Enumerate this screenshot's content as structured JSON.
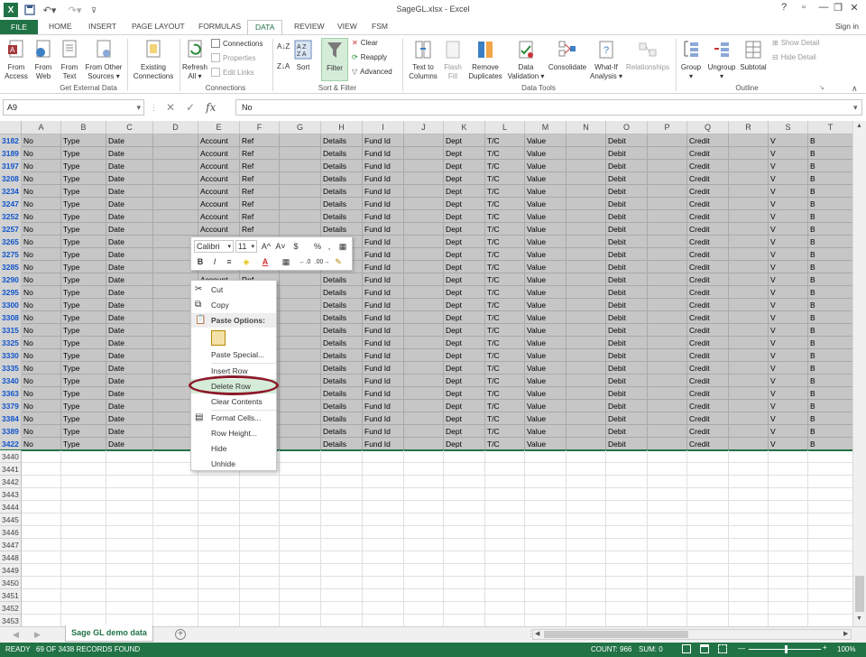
{
  "window": {
    "title": "SageGL.xlsx - Excel",
    "help": "?",
    "min": "—",
    "max": "❐",
    "close": "✕"
  },
  "qat": {
    "app_icon": "excel-logo-icon",
    "save": "save-icon",
    "undo": "undo-icon",
    "redo": "redo-icon",
    "customize": "customize-icon"
  },
  "tabs": [
    {
      "label": "FILE"
    },
    {
      "label": "HOME"
    },
    {
      "label": "INSERT"
    },
    {
      "label": "PAGE LAYOUT"
    },
    {
      "label": "FORMULAS"
    },
    {
      "label": "DATA"
    },
    {
      "label": "REVIEW"
    },
    {
      "label": "VIEW"
    },
    {
      "label": "FSM"
    }
  ],
  "signin": "Sign in",
  "ribbon": {
    "groups": [
      "Get External Data",
      "Connections",
      "Sort & Filter",
      "Data Tools",
      "Outline"
    ],
    "get_external": [
      "From\nAccess",
      "From\nWeb",
      "From\nText",
      "From Other\nSources ▾"
    ],
    "existing": "Existing\nConnections",
    "refresh": "Refresh\nAll ▾",
    "connections": {
      "connections": "Connections",
      "properties": "Properties",
      "edit_links": "Edit Links"
    },
    "sort_az": "A↓Z",
    "sort_za": "Z↓A",
    "sort": "Sort",
    "filter": "Filter",
    "clear": "Clear",
    "reapply": "Reapply",
    "advanced": "Advanced",
    "data_tools": [
      "Text to\nColumns",
      "Flash\nFill",
      "Remove\nDuplicates",
      "Data\nValidation ▾",
      "Consolidate",
      "What-If\nAnalysis ▾",
      "Relationships"
    ],
    "outline": [
      "Group\n▾",
      "Ungroup\n▾",
      "Subtotal"
    ],
    "show_detail": "Show Detail",
    "hide_detail": "Hide Detail",
    "launcher": "↘"
  },
  "formula_bar": {
    "name_box": "A9",
    "formula": "No",
    "cancel": "✕",
    "enter": "✓",
    "fx": "fx"
  },
  "columns": [
    "A",
    "B",
    "C",
    "D",
    "E",
    "F",
    "G",
    "H",
    "I",
    "J",
    "K",
    "L",
    "M",
    "N",
    "O",
    "P",
    "Q",
    "R",
    "S",
    "T"
  ],
  "row_template": [
    "No",
    "Type",
    "Date",
    "",
    "Account",
    "Ref",
    "",
    "Details",
    "Fund Id",
    "",
    "Dept",
    "T/C",
    "Value",
    "",
    "Debit",
    "",
    "Credit",
    "",
    "V",
    "B"
  ],
  "selected_rows": [
    "3182",
    "3189",
    "3197",
    "3208",
    "3234",
    "3247",
    "3252",
    "3257",
    "3265",
    "3275",
    "3285",
    "3290",
    "3295",
    "3300",
    "3308",
    "3315",
    "3325",
    "3330",
    "3335",
    "3340",
    "3363",
    "3379",
    "3384",
    "3389",
    "3422"
  ],
  "empty_rows": [
    "3440",
    "3441",
    "3442",
    "3443",
    "3444",
    "3445",
    "3446",
    "3447",
    "3448",
    "3449",
    "3450",
    "3451",
    "3452",
    "3453"
  ],
  "mini_toolbar": {
    "font": "Calibri",
    "size": "11",
    "grow": "A^",
    "shrink": "A˅",
    "currency": "$",
    "percent": "%",
    "comma": ",",
    "bold": "B",
    "italic": "I",
    "inc_dec": "←.0",
    "dec_dec": ".00→"
  },
  "context_menu": [
    {
      "label": "Cut",
      "icon": "scissors-icon"
    },
    {
      "label": "Copy",
      "icon": "copy-icon"
    },
    {
      "label": "Paste Options:",
      "icon": "paste-icon",
      "header": true
    },
    {
      "label": "",
      "icon": "clipboard-icon"
    },
    {
      "label": "Paste Special...",
      "icon": ""
    },
    {
      "label": "Insert Row",
      "icon": ""
    },
    {
      "label": "Delete Row",
      "icon": "",
      "hover": true
    },
    {
      "label": "Clear Contents",
      "icon": ""
    },
    {
      "label": "Format Cells...",
      "icon": "format-cells-icon"
    },
    {
      "label": "Row Height...",
      "icon": ""
    },
    {
      "label": "Hide",
      "icon": ""
    },
    {
      "label": "Unhide",
      "icon": ""
    }
  ],
  "sheet_tab": "Sage GL demo data",
  "status": {
    "ready": "READY",
    "records": "69 OF 3438 RECORDS FOUND",
    "count": "COUNT: 966",
    "sum": "SUM: 0",
    "zoom": "100%"
  },
  "colors": {
    "accent": "#217346",
    "selected": "#c6c6c6",
    "oval": "#8b1a2a",
    "hover": "#d5ecd9"
  }
}
